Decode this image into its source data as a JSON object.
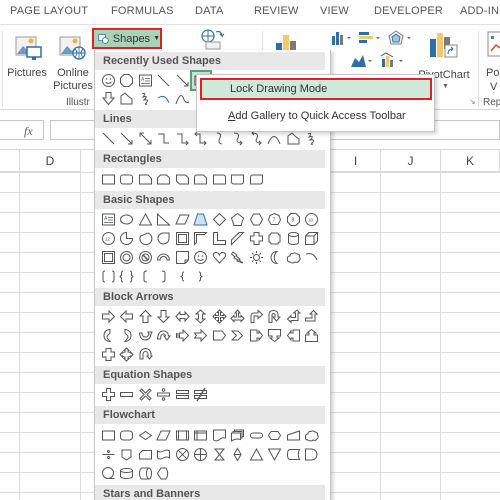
{
  "ribbon_tabs": [
    "PAGE LAYOUT",
    "FORMULAS",
    "DATA",
    "REVIEW",
    "VIEW",
    "DEVELOPER",
    "ADD-IN"
  ],
  "ribbon": {
    "pictures_label": "Pictures",
    "online_pictures_label_1": "Online",
    "online_pictures_label_2": "Pictures",
    "group_illustrations": "Illustr",
    "shapes_button": "Shapes",
    "pivotchart_label": "PivotChart",
    "pivotview_label_1": "Po",
    "pivotview_label_2": "V",
    "group_reports": "Rep"
  },
  "formula_bar": {
    "fx_label": "fx",
    "value": ""
  },
  "columns": [
    "D",
    "I",
    "J",
    "K"
  ],
  "gallery": {
    "sections": [
      {
        "title": "Recently Used Shapes"
      },
      {
        "title": "Lines"
      },
      {
        "title": "Rectangles"
      },
      {
        "title": "Basic Shapes"
      },
      {
        "title": "Block Arrows"
      },
      {
        "title": "Equation Shapes"
      },
      {
        "title": "Flowchart"
      },
      {
        "title": "Stars and Banners"
      }
    ]
  },
  "context_menu": {
    "items": [
      {
        "label": "Lock Drawing Mode",
        "highlighted": true
      },
      {
        "label_accel": "A",
        "label_rest": "dd Gallery to Quick Access Toolbar",
        "highlighted": false
      }
    ]
  },
  "colors": {
    "highlight_border": "#e0202a",
    "shapes_button_bg": "#a8d3b7",
    "menu_highlight_bg": "#cfe8d8"
  }
}
